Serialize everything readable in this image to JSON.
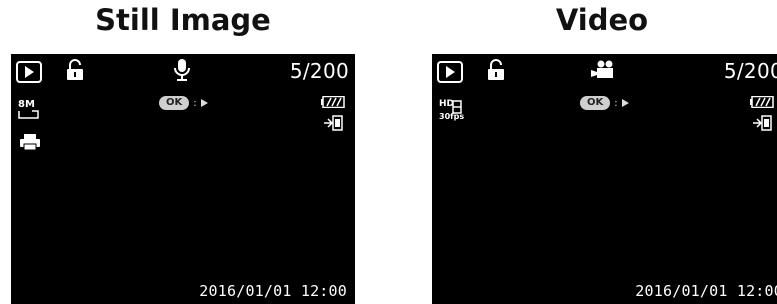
{
  "still": {
    "title": "Still Image",
    "count": "5/200",
    "ok_label": "OK",
    "ok_separator": ":",
    "resolution": "8M",
    "datetime": "2016/01/01 12:00",
    "icons": [
      "play-mode-icon",
      "protect-lock-icon",
      "voice-memo-icon",
      "battery-icon",
      "print-icon",
      "dpof-icon"
    ]
  },
  "video": {
    "title": "Video",
    "count": "5/200",
    "ok_label": "OK",
    "ok_separator": ":",
    "resolution_hd": "HD",
    "fps": "30fps",
    "datetime": "2016/01/01 12:00",
    "icons": [
      "play-mode-icon",
      "protect-lock-icon",
      "video-camera-icon",
      "battery-icon",
      "dpof-icon"
    ]
  },
  "colors": {
    "screen": "#000000",
    "foreground": "#ffffff",
    "ok_badge": "#cfcfcf"
  }
}
